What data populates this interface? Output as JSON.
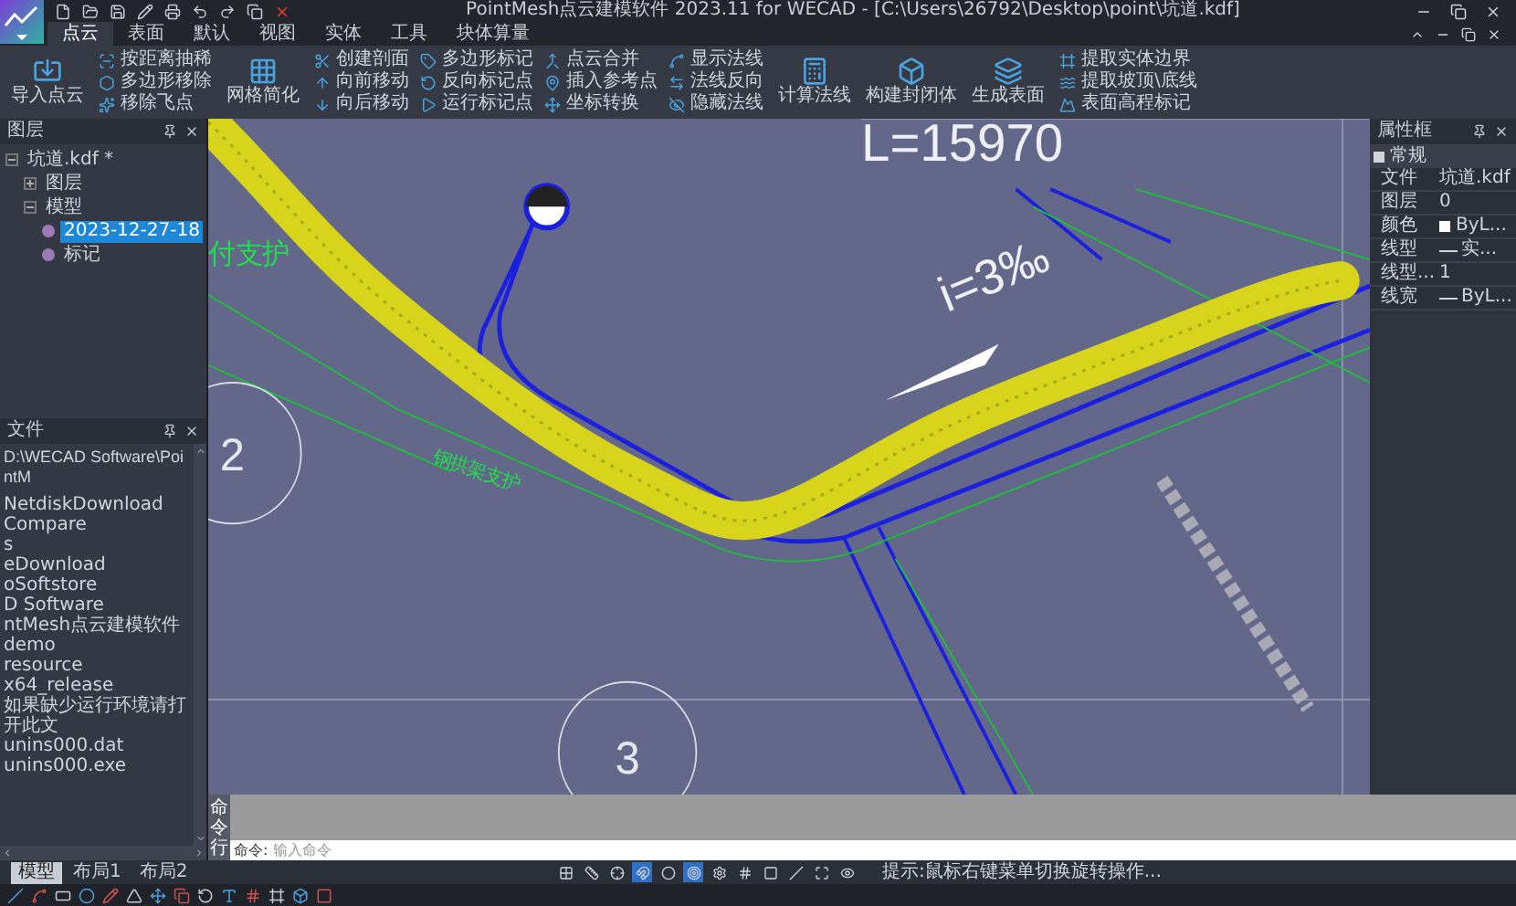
{
  "window": {
    "title": "PointMesh点云建模软件 2023.11 for WECAD - [C:\\Users\\26792\\Desktop\\point\\坑道.kdf]"
  },
  "menu_tabs": [
    {
      "label": "点云",
      "selected": true
    },
    {
      "label": "表面",
      "selected": false
    },
    {
      "label": "默认",
      "selected": false
    },
    {
      "label": "视图",
      "selected": false
    },
    {
      "label": "实体",
      "selected": false
    },
    {
      "label": "工具",
      "selected": false
    },
    {
      "label": "块体算量",
      "selected": false
    }
  ],
  "ribbon": {
    "groups": [
      {
        "kind": "large",
        "items": [
          {
            "label": "导入点云"
          }
        ]
      },
      {
        "kind": "column",
        "items": [
          {
            "label": "按距离抽稀"
          },
          {
            "label": "多边形移除"
          },
          {
            "label": "移除飞点"
          }
        ]
      },
      {
        "kind": "large",
        "items": [
          {
            "label": "网格简化"
          }
        ]
      },
      {
        "kind": "column",
        "items": [
          {
            "label": "创建剖面"
          },
          {
            "label": "向前移动"
          },
          {
            "label": "向后移动"
          }
        ]
      },
      {
        "kind": "column",
        "items": [
          {
            "label": "多边形标记"
          },
          {
            "label": "反向标记点"
          },
          {
            "label": "运行标记点"
          }
        ]
      },
      {
        "kind": "column",
        "items": [
          {
            "label": "点云合并"
          },
          {
            "label": "插入参考点"
          },
          {
            "label": "坐标转换"
          }
        ]
      },
      {
        "kind": "column",
        "items": [
          {
            "label": "显示法线"
          },
          {
            "label": "法线反向"
          },
          {
            "label": "隐藏法线"
          }
        ]
      },
      {
        "kind": "large",
        "items": [
          {
            "label": "计算法线"
          },
          {
            "label": "构建封闭体"
          },
          {
            "label": "生成表面"
          }
        ]
      },
      {
        "kind": "column",
        "items": [
          {
            "label": "提取实体边界"
          },
          {
            "label": "提取坡顶\\底线"
          },
          {
            "label": "表面高程标记"
          }
        ]
      }
    ]
  },
  "layers_panel": {
    "title": "图层",
    "tree": [
      {
        "label": "坑道.kdf *",
        "selected": false,
        "expanded": true,
        "children": [
          {
            "label": "图层",
            "selected": false,
            "expanded": false
          },
          {
            "label": "模型",
            "selected": false,
            "expanded": true,
            "children": [
              {
                "label": "2023-12-27-18",
                "selected": true
              },
              {
                "label": "标记",
                "selected": false
              }
            ]
          }
        ]
      }
    ]
  },
  "files_panel": {
    "title": "文件",
    "path": "D:\\WECAD Software\\PointM",
    "items": [
      "NetdiskDownload",
      "Compare",
      "s",
      "eDownload",
      "oSoftstore",
      "D Software",
      "ntMesh点云建模软件",
      "demo",
      "resource",
      "x64_release",
      "如果缺少运行环境请打开此文",
      "unins000.dat",
      "unins000.exe"
    ]
  },
  "canvas": {
    "dimension_text": "L=15970",
    "slope_text": "i=3‰",
    "section_markers": [
      "2",
      "3"
    ],
    "support_labels": [
      "付支护",
      "钢拱架支护"
    ]
  },
  "properties_panel": {
    "title": "属性框",
    "section": "常规",
    "rows": [
      {
        "kind": "text",
        "label": "文件",
        "value": "坑道.kdf"
      },
      {
        "kind": "text",
        "label": "图层",
        "value": "0"
      },
      {
        "kind": "color",
        "label": "颜色",
        "value": "ByL..."
      },
      {
        "kind": "linetype",
        "label": "线型",
        "value": "实..."
      },
      {
        "kind": "text",
        "label": "线型...",
        "value": "1"
      },
      {
        "kind": "linetype",
        "label": "线宽",
        "value": "ByL..."
      }
    ]
  },
  "command": {
    "side_label": "命令行",
    "prompt": "命令:",
    "placeholder": "输入命令"
  },
  "layout_tabs": [
    {
      "label": "模型",
      "selected": true
    },
    {
      "label": "布局1",
      "selected": false
    },
    {
      "label": "布局2",
      "selected": false
    }
  ],
  "status_bar": {
    "toggles": [
      {
        "on": false
      },
      {
        "on": false
      },
      {
        "on": false
      },
      {
        "on": true
      },
      {
        "on": false
      },
      {
        "on": true
      },
      {
        "on": false
      },
      {
        "on": false
      },
      {
        "on": false
      },
      {
        "on": false
      },
      {
        "on": false
      },
      {
        "on": false
      }
    ],
    "hint": "提示:鼠标右键菜单切换旋转操作..."
  }
}
